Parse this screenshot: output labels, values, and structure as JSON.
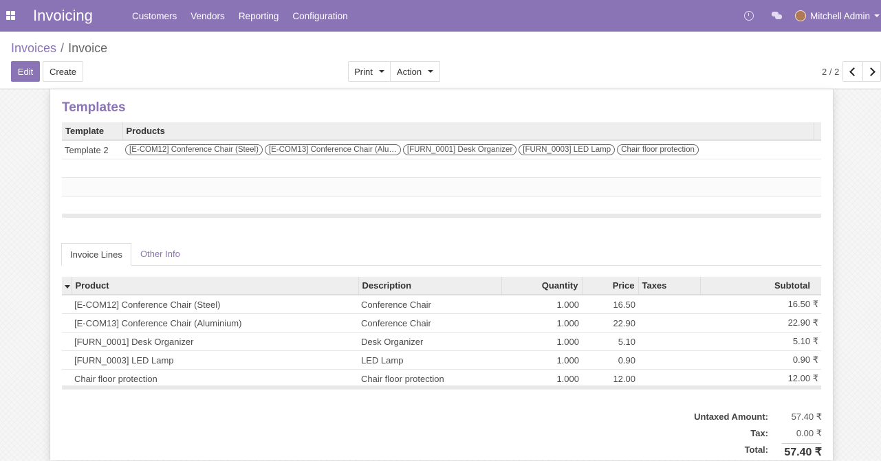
{
  "navbar": {
    "app_title": "Invoicing",
    "menu": [
      "Customers",
      "Vendors",
      "Reporting",
      "Configuration"
    ],
    "user_name": "Mitchell Admin",
    "accent_color": "#8a74b5"
  },
  "breadcrumb": {
    "parent": "Invoices",
    "separator": "/",
    "current": "Invoice"
  },
  "toolbar": {
    "edit_label": "Edit",
    "create_label": "Create",
    "print_label": "Print",
    "action_label": "Action"
  },
  "pager": {
    "value": "2 / 2"
  },
  "templates": {
    "title": "Templates",
    "headers": {
      "template": "Template",
      "products": "Products"
    },
    "rows": [
      {
        "template": "Template 2",
        "products": [
          "[E-COM12] Conference Chair (Steel)",
          "[E-COM13] Conference Chair (Alu…",
          "[FURN_0001] Desk Organizer",
          "[FURN_0003] LED Lamp",
          "Chair floor protection"
        ]
      }
    ]
  },
  "tabs": {
    "invoice_lines": "Invoice Lines",
    "other_info": "Other Info"
  },
  "lines": {
    "headers": {
      "product": "Product",
      "description": "Description",
      "quantity": "Quantity",
      "price": "Price",
      "taxes": "Taxes",
      "subtotal": "Subtotal"
    },
    "rows": [
      {
        "product": "[E-COM12] Conference Chair (Steel)",
        "description": "Conference Chair",
        "quantity": "1.000",
        "price": "16.50",
        "taxes": "",
        "subtotal": "16.50 ₹"
      },
      {
        "product": "[E-COM13] Conference Chair (Aluminium)",
        "description": "Conference Chair",
        "quantity": "1.000",
        "price": "22.90",
        "taxes": "",
        "subtotal": "22.90 ₹"
      },
      {
        "product": "[FURN_0001] Desk Organizer",
        "description": "Desk Organizer",
        "quantity": "1.000",
        "price": "5.10",
        "taxes": "",
        "subtotal": "5.10 ₹"
      },
      {
        "product": "[FURN_0003] LED Lamp",
        "description": "LED Lamp",
        "quantity": "1.000",
        "price": "0.90",
        "taxes": "",
        "subtotal": "0.90 ₹"
      },
      {
        "product": "Chair floor protection",
        "description": "Chair floor protection",
        "quantity": "1.000",
        "price": "12.00",
        "taxes": "",
        "subtotal": "12.00 ₹"
      }
    ]
  },
  "totals": {
    "untaxed_label": "Untaxed Amount:",
    "untaxed_value": "57.40 ₹",
    "tax_label": "Tax:",
    "tax_value": "0.00 ₹",
    "total_label": "Total:",
    "total_value": "57.40 ₹"
  }
}
